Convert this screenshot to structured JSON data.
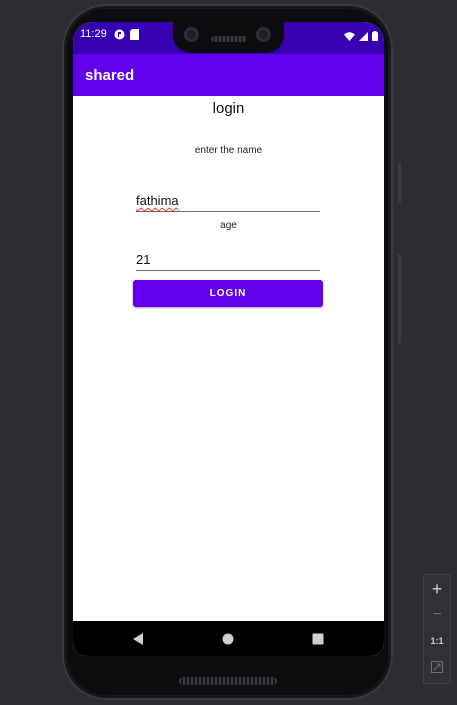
{
  "status_bar": {
    "time": "11:29"
  },
  "app_bar": {
    "title": "shared"
  },
  "form": {
    "heading": "login",
    "name_label": "enter the name",
    "name_value": "fathima",
    "age_label": "age",
    "age_value": "21",
    "login_button": "LOGIN"
  },
  "colors": {
    "status_bar": "#3700b3",
    "primary": "#6200ee",
    "background": "#ffffff"
  },
  "emulator_toolbar": {
    "zoom_in": "+",
    "zoom_out": "−",
    "actual_size": "1:1"
  }
}
